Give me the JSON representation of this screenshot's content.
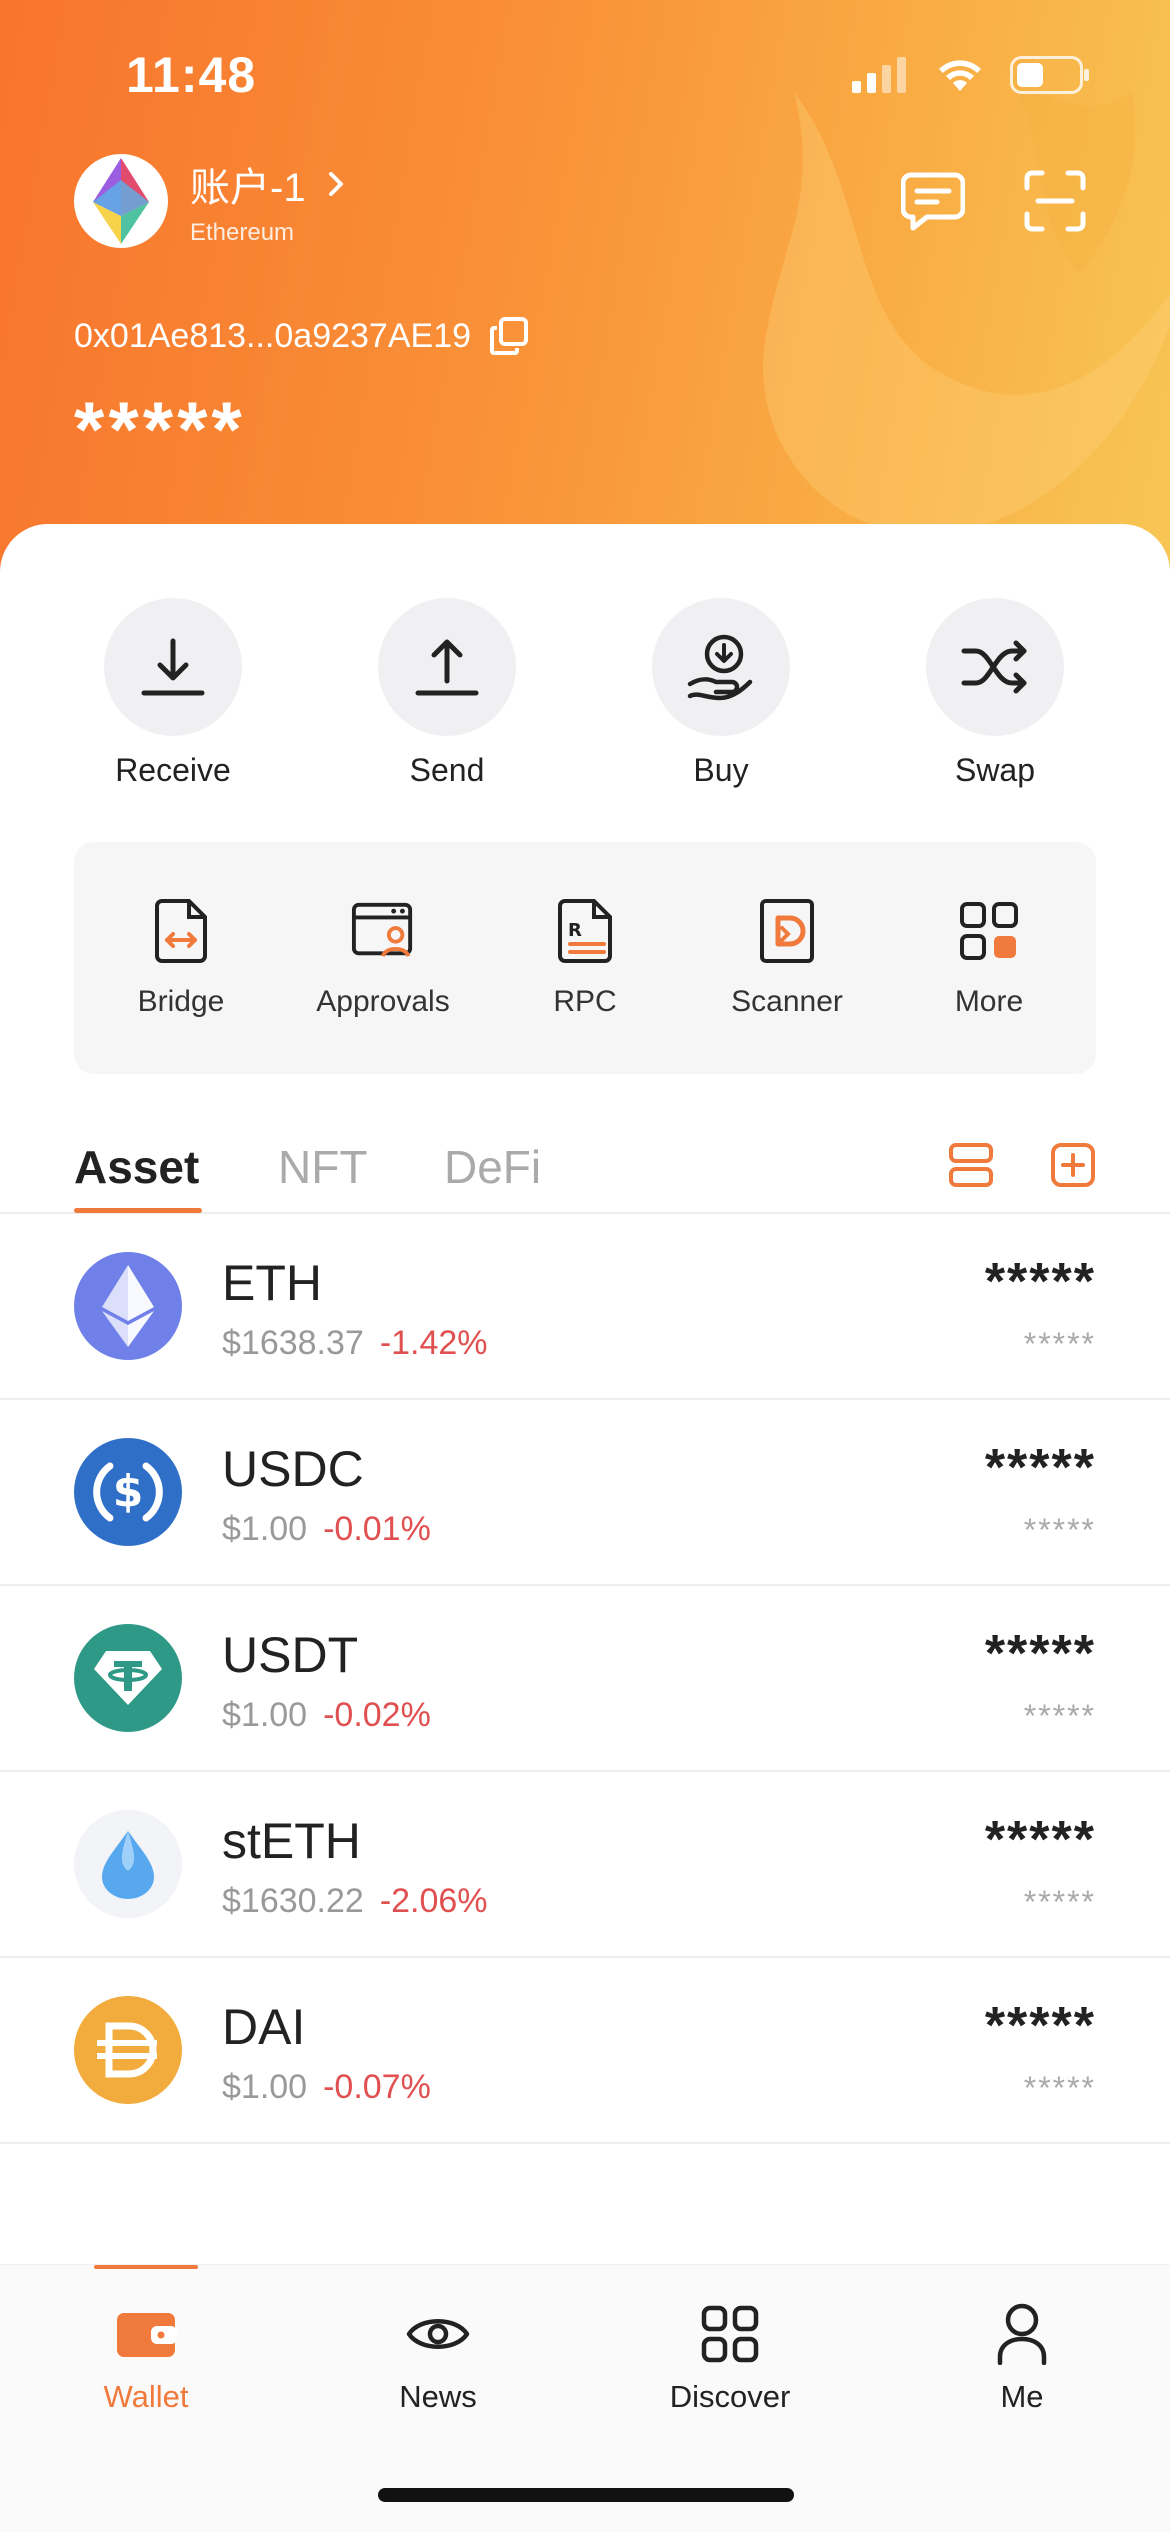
{
  "status": {
    "time": "11:48"
  },
  "account": {
    "name": "账户-1",
    "chain": "Ethereum",
    "address": "0x01Ae813...0a9237AE19",
    "balance_masked": "*****"
  },
  "quick_actions": [
    {
      "label": "Receive",
      "icon": "receive-arrow-icon"
    },
    {
      "label": "Send",
      "icon": "send-arrow-icon"
    },
    {
      "label": "Buy",
      "icon": "buy-coin-hand-icon"
    },
    {
      "label": "Swap",
      "icon": "swap-shuffle-icon"
    }
  ],
  "tools": [
    {
      "label": "Bridge",
      "icon": "bridge-icon"
    },
    {
      "label": "Approvals",
      "icon": "approvals-icon"
    },
    {
      "label": "RPC",
      "icon": "rpc-icon"
    },
    {
      "label": "Scanner",
      "icon": "scanner-icon"
    },
    {
      "label": "More",
      "icon": "more-grid-icon"
    }
  ],
  "tabs": [
    {
      "label": "Asset",
      "active": true
    },
    {
      "label": "NFT",
      "active": false
    },
    {
      "label": "DeFi",
      "active": false
    }
  ],
  "assets": [
    {
      "symbol": "ETH",
      "price": "$1638.37",
      "change": "-1.42%",
      "amount": "*****",
      "value": "*****",
      "logo_color": "#6f80e8"
    },
    {
      "symbol": "USDC",
      "price": "$1.00",
      "change": "-0.01%",
      "amount": "*****",
      "value": "*****",
      "logo_color": "#2f6fc7"
    },
    {
      "symbol": "USDT",
      "price": "$1.00",
      "change": "-0.02%",
      "amount": "*****",
      "value": "*****",
      "logo_color": "#2f9987"
    },
    {
      "symbol": "stETH",
      "price": "$1630.22",
      "change": "-2.06%",
      "amount": "*****",
      "value": "*****",
      "logo_color": "#f2f4f7"
    },
    {
      "symbol": "DAI",
      "price": "$1.00",
      "change": "-0.07%",
      "amount": "*****",
      "value": "*****",
      "logo_color": "#f2ac3d"
    }
  ],
  "bottom_nav": [
    {
      "label": "Wallet",
      "icon": "wallet-icon",
      "active": true
    },
    {
      "label": "News",
      "icon": "eye-icon",
      "active": false
    },
    {
      "label": "Discover",
      "icon": "discover-grid-icon",
      "active": false
    },
    {
      "label": "Me",
      "icon": "person-icon",
      "active": false
    }
  ],
  "colors": {
    "accent": "#f07a3c",
    "negative": "#e05050",
    "header_start": "#f8742c",
    "header_end": "#f8c655"
  }
}
